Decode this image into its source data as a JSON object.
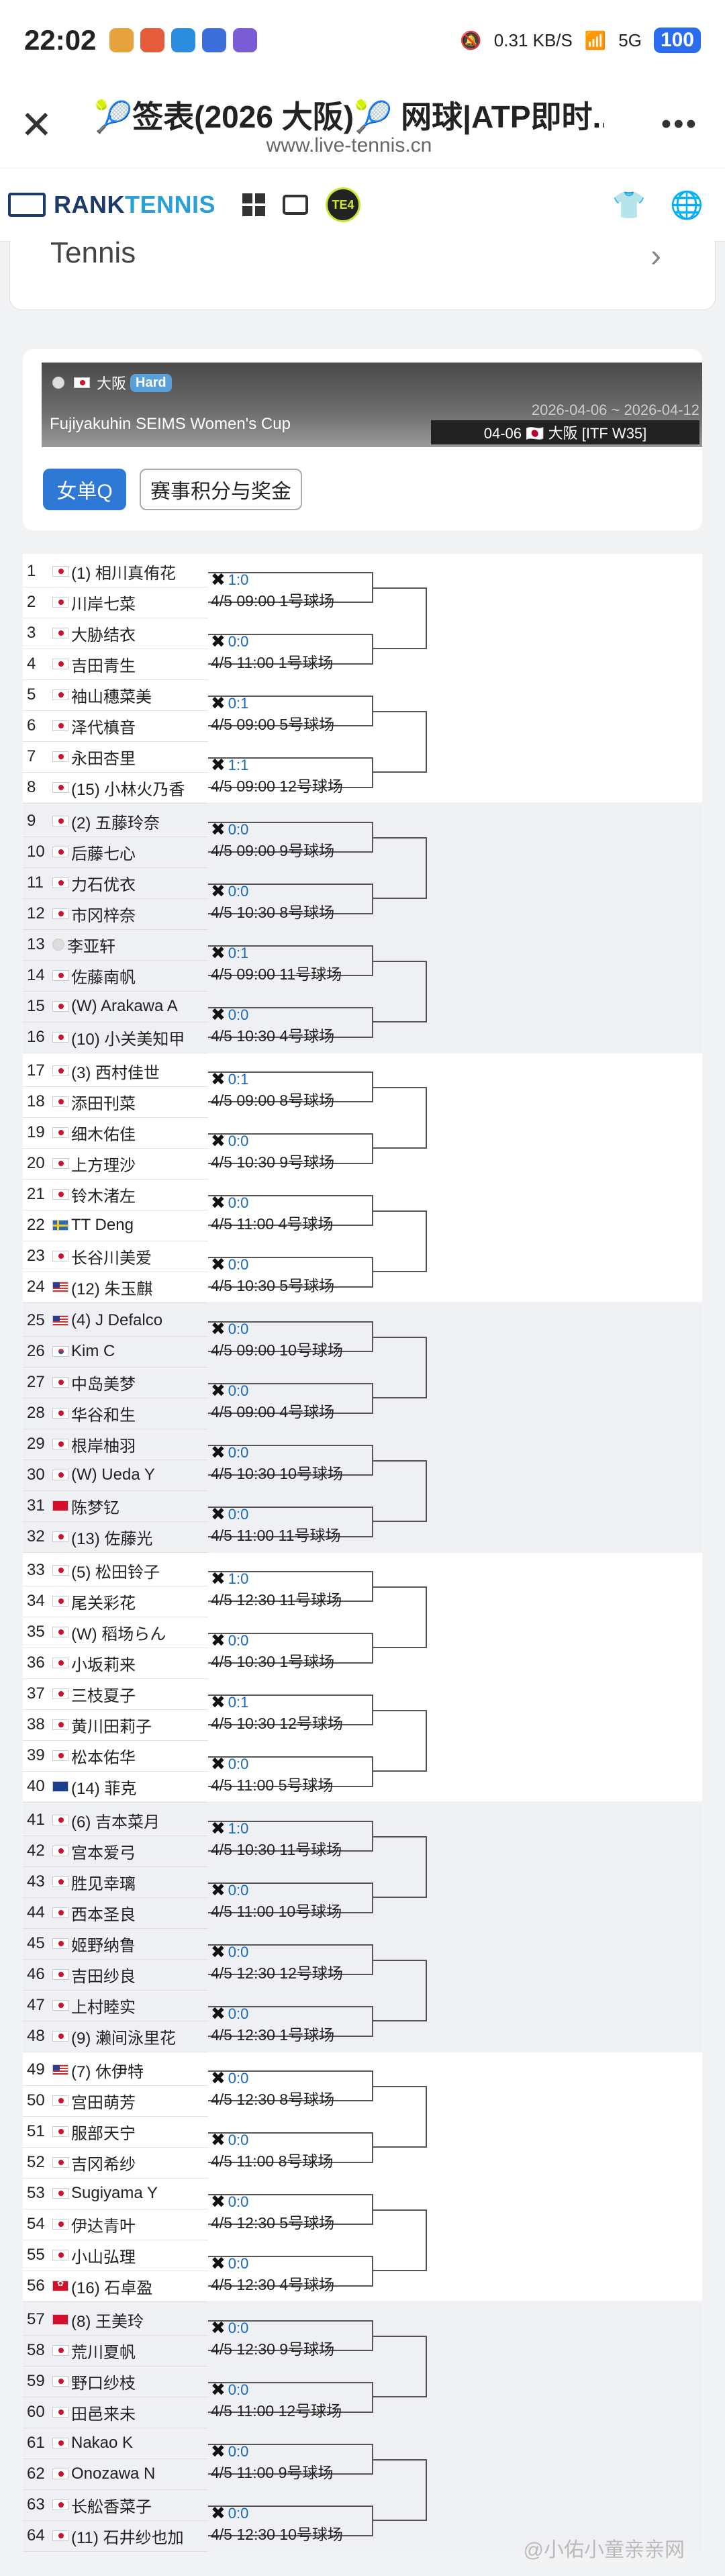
{
  "status_bar": {
    "time": "22:02",
    "net_speed": "0.31 KB/S",
    "signal": "5G",
    "battery": "100"
  },
  "browser": {
    "title": "🎾签表(2026 大阪)🎾 网球|ATP即时...",
    "url": "www.live-tennis.cn",
    "close_icon": "close-icon",
    "more_icon": "more-icon"
  },
  "site_nav": {
    "logo_part1": "RANK",
    "logo_part2": "TENNIS",
    "te4": "TE4"
  },
  "sport_card": {
    "label": "Tennis"
  },
  "tournament": {
    "country": "大阪",
    "surface": "Hard",
    "name": "Fujiyakuhin SEIMS Women's Cup",
    "dates": "2026-04-06 ~ 2026-04-12",
    "sub": "04-06 🇯🇵 大阪 [ITF W35]",
    "tab_active": "女单Q",
    "tab_other": "赛事积分与奖金"
  },
  "players": [
    {
      "n": "1",
      "flag": "jp",
      "name": "(1) 相川真侑花"
    },
    {
      "n": "2",
      "flag": "jp",
      "name": "川岸七菜"
    },
    {
      "n": "3",
      "flag": "jp",
      "name": "大胁结衣"
    },
    {
      "n": "4",
      "flag": "jp",
      "name": "吉田青生"
    },
    {
      "n": "5",
      "flag": "jp",
      "name": "袖山穗菜美"
    },
    {
      "n": "6",
      "flag": "jp",
      "name": "泽代槙音"
    },
    {
      "n": "7",
      "flag": "jp",
      "name": "永田杏里"
    },
    {
      "n": "8",
      "flag": "jp",
      "name": "(15) 小林火乃香"
    },
    {
      "n": "9",
      "flag": "jp",
      "name": "(2) 五藤玲奈"
    },
    {
      "n": "10",
      "flag": "jp",
      "name": "后藤七心"
    },
    {
      "n": "11",
      "flag": "jp",
      "name": "力石优衣"
    },
    {
      "n": "12",
      "flag": "jp",
      "name": "市冈梓奈"
    },
    {
      "n": "13",
      "flag": "un",
      "name": "李亚轩"
    },
    {
      "n": "14",
      "flag": "jp",
      "name": "佐藤南帆"
    },
    {
      "n": "15",
      "flag": "jp",
      "name": "(W) Arakawa A"
    },
    {
      "n": "16",
      "flag": "jp",
      "name": "(10) 小关美知甲"
    },
    {
      "n": "17",
      "flag": "jp",
      "name": "(3) 西村佳世"
    },
    {
      "n": "18",
      "flag": "jp",
      "name": "添田刊菜"
    },
    {
      "n": "19",
      "flag": "jp",
      "name": "细木佑佳"
    },
    {
      "n": "20",
      "flag": "jp",
      "name": "上方理沙"
    },
    {
      "n": "21",
      "flag": "jp",
      "name": "铃木渚左"
    },
    {
      "n": "22",
      "flag": "se",
      "name": "TT Deng"
    },
    {
      "n": "23",
      "flag": "jp",
      "name": "长谷川美爱"
    },
    {
      "n": "24",
      "flag": "us",
      "name": "(12) 朱玉麒"
    },
    {
      "n": "25",
      "flag": "us",
      "name": "(4) J Defalco"
    },
    {
      "n": "26",
      "flag": "kr",
      "name": "Kim C"
    },
    {
      "n": "27",
      "flag": "jp",
      "name": "中岛美梦"
    },
    {
      "n": "28",
      "flag": "jp",
      "name": "华谷和生"
    },
    {
      "n": "29",
      "flag": "jp",
      "name": "根岸柚羽"
    },
    {
      "n": "30",
      "flag": "jp",
      "name": "(W) Ueda Y"
    },
    {
      "n": "31",
      "flag": "cn",
      "name": "陈梦钇"
    },
    {
      "n": "32",
      "flag": "jp",
      "name": "(13) 佐藤光"
    },
    {
      "n": "33",
      "flag": "jp",
      "name": "(5) 松田铃子"
    },
    {
      "n": "34",
      "flag": "jp",
      "name": "尾关彩花"
    },
    {
      "n": "35",
      "flag": "jp",
      "name": "(W) 稻场らん"
    },
    {
      "n": "36",
      "flag": "jp",
      "name": "小坂莉来"
    },
    {
      "n": "37",
      "flag": "jp",
      "name": "三枝夏子"
    },
    {
      "n": "38",
      "flag": "jp",
      "name": "黄川田莉子"
    },
    {
      "n": "39",
      "flag": "jp",
      "name": "松本佑华"
    },
    {
      "n": "40",
      "flag": "au",
      "name": "(14) 菲克"
    },
    {
      "n": "41",
      "flag": "jp",
      "name": "(6) 吉本菜月"
    },
    {
      "n": "42",
      "flag": "jp",
      "name": "宫本爱弓"
    },
    {
      "n": "43",
      "flag": "jp",
      "name": "胜见幸璃"
    },
    {
      "n": "44",
      "flag": "jp",
      "name": "西本圣良"
    },
    {
      "n": "45",
      "flag": "jp",
      "name": "姬野纳鲁"
    },
    {
      "n": "46",
      "flag": "jp",
      "name": "吉田纱良"
    },
    {
      "n": "47",
      "flag": "jp",
      "name": "上村睦实"
    },
    {
      "n": "48",
      "flag": "jp",
      "name": "(9) 濑间泳里花"
    },
    {
      "n": "49",
      "flag": "us",
      "name": "(7) 休伊特"
    },
    {
      "n": "50",
      "flag": "jp",
      "name": "宫田萌芳"
    },
    {
      "n": "51",
      "flag": "jp",
      "name": "服部天宁"
    },
    {
      "n": "52",
      "flag": "jp",
      "name": "吉冈希纱"
    },
    {
      "n": "53",
      "flag": "jp",
      "name": "Sugiyama Y"
    },
    {
      "n": "54",
      "flag": "jp",
      "name": "伊达青叶"
    },
    {
      "n": "55",
      "flag": "jp",
      "name": "小山弘理"
    },
    {
      "n": "56",
      "flag": "hk",
      "name": "(16) 石卓盈"
    },
    {
      "n": "57",
      "flag": "cn",
      "name": "(8) 王美玲"
    },
    {
      "n": "58",
      "flag": "jp",
      "name": "荒川夏帆"
    },
    {
      "n": "59",
      "flag": "jp",
      "name": "野口纱枝"
    },
    {
      "n": "60",
      "flag": "jp",
      "name": "田邑来未"
    },
    {
      "n": "61",
      "flag": "jp",
      "name": "Nakao K"
    },
    {
      "n": "62",
      "flag": "jp",
      "name": "Onozawa N"
    },
    {
      "n": "63",
      "flag": "jp",
      "name": "长舩香菜子"
    },
    {
      "n": "64",
      "flag": "jp",
      "name": "(11) 石井纱也加"
    }
  ],
  "matches": [
    {
      "score": "1:0",
      "time": "4/5 09:00 1号球场"
    },
    {
      "score": "0:0",
      "time": "4/5 11:00 1号球场"
    },
    {
      "score": "0:1",
      "time": "4/5 09:00 5号球场"
    },
    {
      "score": "1:1",
      "time": "4/5 09:00 12号球场"
    },
    {
      "score": "0:0",
      "time": "4/5 09:00 9号球场"
    },
    {
      "score": "0:0",
      "time": "4/5 10:30 8号球场"
    },
    {
      "score": "0:1",
      "time": "4/5 09:00 11号球场"
    },
    {
      "score": "0:0",
      "time": "4/5 10:30 4号球场"
    },
    {
      "score": "0:1",
      "time": "4/5 09:00 8号球场"
    },
    {
      "score": "0:0",
      "time": "4/5 10:30 9号球场"
    },
    {
      "score": "0:0",
      "time": "4/5 11:00 4号球场"
    },
    {
      "score": "0:0",
      "time": "4/5 10:30 5号球场"
    },
    {
      "score": "0:0",
      "time": "4/5 09:00 10号球场"
    },
    {
      "score": "0:0",
      "time": "4/5 09:00 4号球场"
    },
    {
      "score": "0:0",
      "time": "4/5 10:30 10号球场"
    },
    {
      "score": "0:0",
      "time": "4/5 11:00 11号球场"
    },
    {
      "score": "1:0",
      "time": "4/5 12:30 11号球场"
    },
    {
      "score": "0:0",
      "time": "4/5 10:30 1号球场"
    },
    {
      "score": "0:1",
      "time": "4/5 10:30 12号球场"
    },
    {
      "score": "0:0",
      "time": "4/5 11:00 5号球场"
    },
    {
      "score": "1:0",
      "time": "4/5 10:30 11号球场"
    },
    {
      "score": "0:0",
      "time": "4/5 11:00 10号球场"
    },
    {
      "score": "0:0",
      "time": "4/5 12:30 12号球场"
    },
    {
      "score": "0:0",
      "time": "4/5 12:30 1号球场"
    },
    {
      "score": "0:0",
      "time": "4/5 12:30 8号球场"
    },
    {
      "score": "0:0",
      "time": "4/5 11:00 8号球场"
    },
    {
      "score": "0:0",
      "time": "4/5 12:30 5号球场"
    },
    {
      "score": "0:0",
      "time": "4/5 12:30 4号球场"
    },
    {
      "score": "0:0",
      "time": "4/5 12:30 9号球场"
    },
    {
      "score": "0:0",
      "time": "4/5 11:00 12号球场"
    },
    {
      "score": "0:0",
      "time": "4/5 11:00 9号球场"
    },
    {
      "score": "0:0",
      "time": "4/5 12:30 10号球场"
    }
  ],
  "watermark": "@小佑小童亲亲网"
}
